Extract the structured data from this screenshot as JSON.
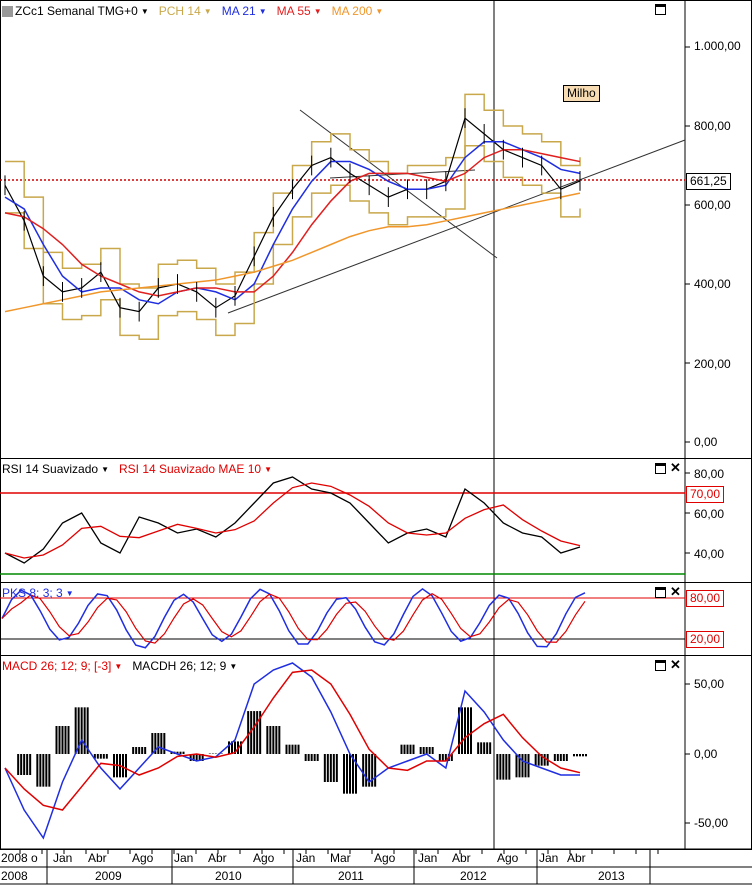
{
  "header": {
    "symbol": "ZCc1 Semanal TMG+0",
    "ind1": "PCH 14",
    "ind2": "MA 21",
    "ind3": "MA 55",
    "ind4": "MA 200",
    "note": "Milho",
    "last_price": "661,25"
  },
  "rsi_panel": {
    "label1": "RSI 14 Suavizado",
    "label2": "RSI 14 Suavizado MAE 10",
    "level_high": "70,00"
  },
  "pks_panel": {
    "label": "PKS 8; 3; 3",
    "level_high": "80,00",
    "level_low": "20,00"
  },
  "macd_panel": {
    "label1": "MACD 26; 12; 9; [-3]",
    "label2": "MACDH 26; 12; 9"
  },
  "price_axis": [
    "1.000,00",
    "800,00",
    "600,00",
    "400,00",
    "200,00",
    "0,00"
  ],
  "rsi_axis": [
    "80,00",
    "60,00",
    "40,00"
  ],
  "macd_axis": [
    "50,00",
    "0,00",
    "-50,00"
  ],
  "months": [
    "2008",
    "o",
    "Jan",
    "Abr",
    "Ago",
    "Jan",
    "Abr",
    "Ago",
    "Jan",
    "Mar",
    "Ago",
    "Jan",
    "Abr",
    "Ago",
    "Jan",
    "Abr"
  ],
  "years": [
    "2008",
    "2009",
    "2010",
    "2011",
    "2012",
    "2013"
  ],
  "colors": {
    "pch": "#c8a84b",
    "ma21": "#1f2ee0",
    "ma55": "#e01f1f",
    "ma200": "#f0962a",
    "rsi_hi": "#e00000",
    "rsi_lo": "#008a00"
  },
  "chart_data": {
    "type": "line",
    "x": [
      "2008-06",
      "2008-08",
      "2008-10",
      "2008-12",
      "2009-02",
      "2009-04",
      "2009-06",
      "2009-08",
      "2009-10",
      "2009-12",
      "2010-02",
      "2010-04",
      "2010-06",
      "2010-08",
      "2010-10",
      "2010-12",
      "2011-02",
      "2011-04",
      "2011-06",
      "2011-08",
      "2011-10",
      "2011-12",
      "2012-02",
      "2012-04",
      "2012-06",
      "2012-08",
      "2012-10",
      "2012-12",
      "2013-02",
      "2013-04",
      "2013-05"
    ],
    "series": [
      {
        "name": "ZCc1",
        "values": [
          650,
          560,
          420,
          380,
          390,
          430,
          340,
          330,
          390,
          400,
          380,
          340,
          370,
          470,
          570,
          640,
          700,
          720,
          680,
          650,
          620,
          640,
          640,
          660,
          820,
          780,
          740,
          720,
          700,
          640,
          661
        ]
      },
      {
        "name": "MA 21",
        "values": [
          620,
          590,
          500,
          420,
          380,
          390,
          390,
          360,
          350,
          380,
          390,
          380,
          360,
          400,
          500,
          590,
          660,
          710,
          710,
          690,
          660,
          640,
          640,
          650,
          720,
          760,
          760,
          740,
          720,
          690,
          680
        ]
      },
      {
        "name": "MA 55",
        "values": [
          580,
          570,
          540,
          500,
          450,
          420,
          400,
          380,
          370,
          380,
          390,
          390,
          380,
          380,
          420,
          480,
          550,
          610,
          660,
          680,
          680,
          680,
          670,
          660,
          680,
          720,
          740,
          740,
          730,
          720,
          710
        ]
      },
      {
        "name": "MA 200",
        "values": [
          330,
          340,
          350,
          360,
          370,
          380,
          385,
          390,
          395,
          400,
          405,
          410,
          420,
          430,
          445,
          460,
          480,
          500,
          520,
          535,
          545,
          545,
          550,
          560,
          570,
          580,
          590,
          600,
          610,
          620,
          630
        ]
      }
    ],
    "ylim": [
      0,
      1100
    ],
    "rsi": {
      "values": [
        40,
        35,
        42,
        55,
        60,
        45,
        40,
        58,
        55,
        50,
        52,
        48,
        55,
        65,
        75,
        78,
        72,
        70,
        65,
        55,
        45,
        50,
        52,
        48,
        72,
        65,
        55,
        50,
        48,
        40,
        43
      ],
      "levels": [
        70,
        30
      ],
      "ylim": [
        30,
        85
      ]
    },
    "pks": {
      "levels": [
        80,
        20
      ]
    },
    "macd": {
      "values": [
        -10,
        -40,
        -60,
        -20,
        10,
        -10,
        -25,
        -10,
        5,
        0,
        -5,
        -2,
        10,
        50,
        60,
        65,
        55,
        30,
        0,
        -20,
        -10,
        -5,
        0,
        -10,
        45,
        30,
        10,
        -5,
        -10,
        -15,
        -15
      ],
      "ylim": [
        -70,
        70
      ]
    }
  }
}
